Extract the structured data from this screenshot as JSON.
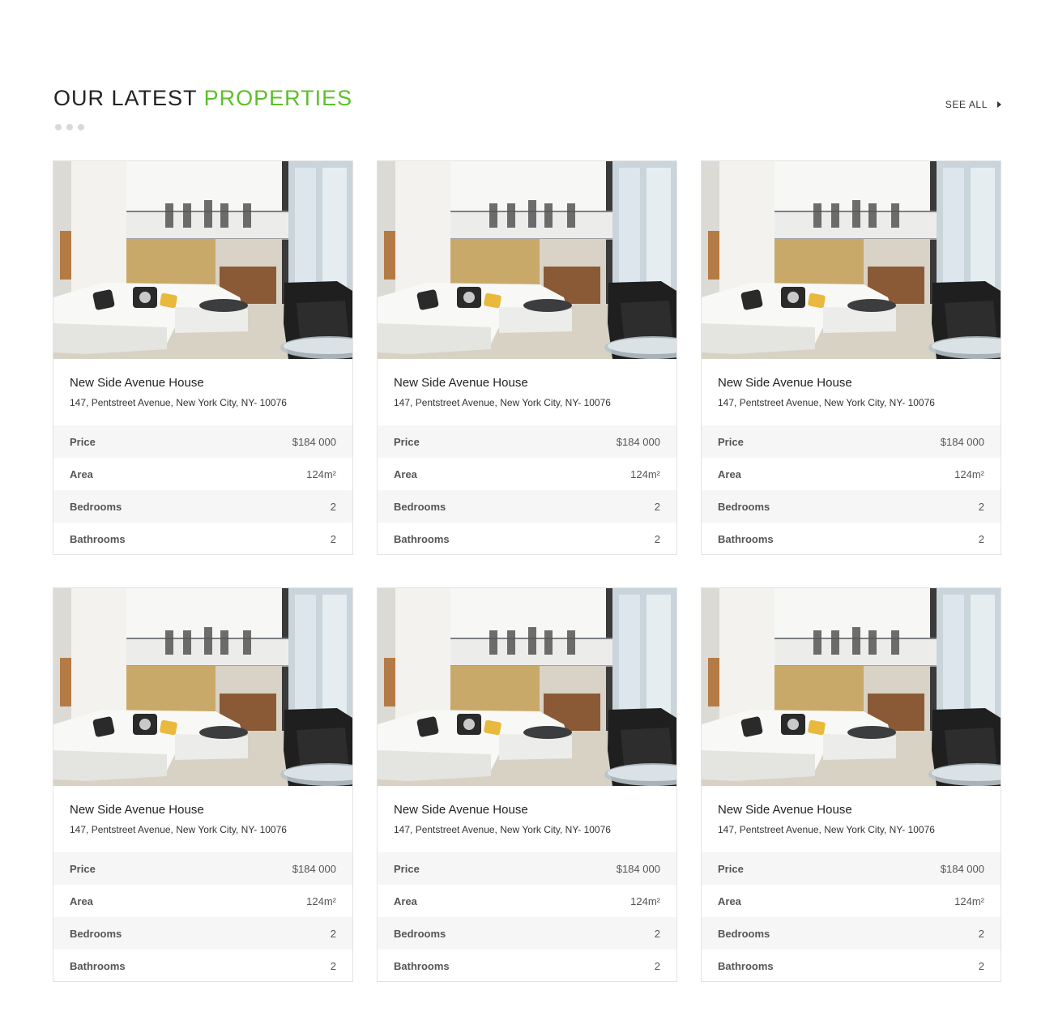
{
  "section": {
    "title_main": "OUR LATEST",
    "title_accent": "PROPERTIES",
    "see_all_label": "SEE ALL",
    "accent_color": "#5cbf2a"
  },
  "properties": [
    {
      "title": "New Side Avenue House",
      "address": "147, Pentstreet Avenue, New York City, NY- 10076",
      "specs": [
        {
          "label": "Price",
          "value": "$184 000"
        },
        {
          "label": "Area",
          "value": "124m²"
        },
        {
          "label": "Bedrooms",
          "value": "2"
        },
        {
          "label": "Bathrooms",
          "value": "2"
        }
      ]
    },
    {
      "title": "New Side Avenue House",
      "address": "147, Pentstreet Avenue, New York City, NY- 10076",
      "specs": [
        {
          "label": "Price",
          "value": "$184 000"
        },
        {
          "label": "Area",
          "value": "124m²"
        },
        {
          "label": "Bedrooms",
          "value": "2"
        },
        {
          "label": "Bathrooms",
          "value": "2"
        }
      ]
    },
    {
      "title": "New Side Avenue House",
      "address": "147, Pentstreet Avenue, New York City, NY- 10076",
      "specs": [
        {
          "label": "Price",
          "value": "$184 000"
        },
        {
          "label": "Area",
          "value": "124m²"
        },
        {
          "label": "Bedrooms",
          "value": "2"
        },
        {
          "label": "Bathrooms",
          "value": "2"
        }
      ]
    },
    {
      "title": "New Side Avenue House",
      "address": "147, Pentstreet Avenue, New York City, NY- 10076",
      "specs": [
        {
          "label": "Price",
          "value": "$184 000"
        },
        {
          "label": "Area",
          "value": "124m²"
        },
        {
          "label": "Bedrooms",
          "value": "2"
        },
        {
          "label": "Bathrooms",
          "value": "2"
        }
      ]
    },
    {
      "title": "New Side Avenue House",
      "address": "147, Pentstreet Avenue, New York City, NY- 10076",
      "specs": [
        {
          "label": "Price",
          "value": "$184 000"
        },
        {
          "label": "Area",
          "value": "124m²"
        },
        {
          "label": "Bedrooms",
          "value": "2"
        },
        {
          "label": "Bathrooms",
          "value": "2"
        }
      ]
    },
    {
      "title": "New Side Avenue House",
      "address": "147, Pentstreet Avenue, New York City, NY- 10076",
      "specs": [
        {
          "label": "Price",
          "value": "$184 000"
        },
        {
          "label": "Area",
          "value": "124m²"
        },
        {
          "label": "Bedrooms",
          "value": "2"
        },
        {
          "label": "Bathrooms",
          "value": "2"
        }
      ]
    }
  ]
}
